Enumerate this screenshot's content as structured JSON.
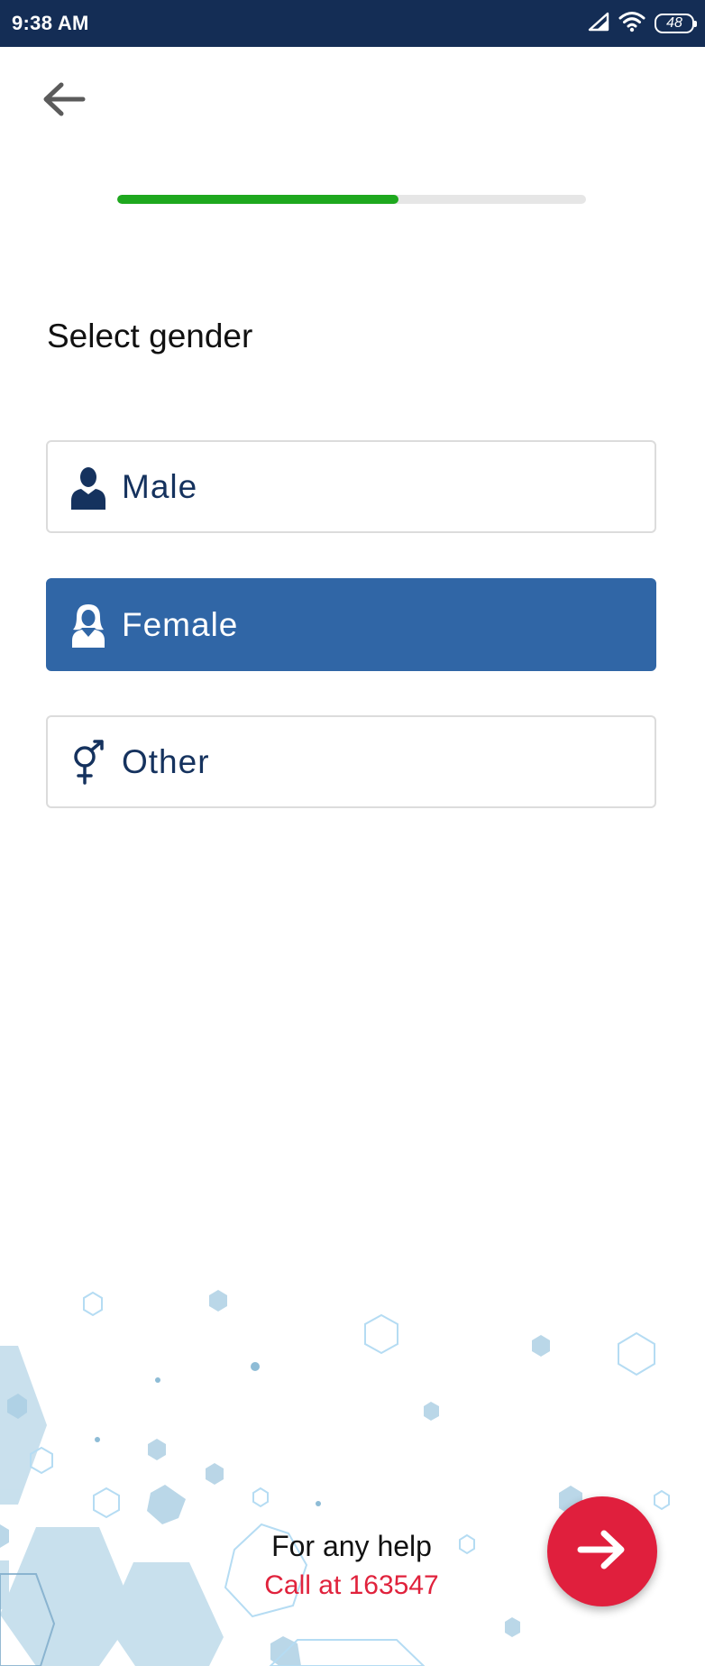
{
  "status_bar": {
    "time": "9:38 AM",
    "battery": "48",
    "icons": [
      "signal-icon",
      "wifi-icon",
      "battery-icon"
    ]
  },
  "nav": {
    "back_icon": "arrow-left-icon"
  },
  "progress": {
    "fraction": 0.6,
    "fill_color": "#1ea81e",
    "track_color": "#e6e6e6"
  },
  "page": {
    "title": "Select gender"
  },
  "options": [
    {
      "label": "Male",
      "icon": "male-user-icon",
      "selected": false
    },
    {
      "label": "Female",
      "icon": "female-user-icon",
      "selected": true
    },
    {
      "label": "Other",
      "icon": "gender-symbol-icon",
      "selected": false
    }
  ],
  "footer": {
    "help_text": "For any help",
    "help_phone": "Call at 163547",
    "next_icon": "arrow-right-icon"
  },
  "colors": {
    "status_bar": "#142d55",
    "selected": "#3066a6",
    "text_primary": "#15325e",
    "accent_red": "#e01f3d"
  }
}
